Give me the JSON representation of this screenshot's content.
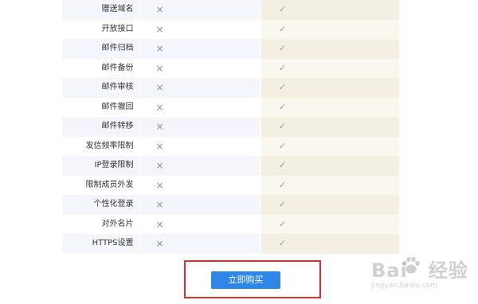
{
  "features": [
    {
      "name": "赠送域名",
      "basic": "×",
      "premium": "✓"
    },
    {
      "name": "开放接口",
      "basic": "×",
      "premium": "✓"
    },
    {
      "name": "邮件归档",
      "basic": "×",
      "premium": "✓"
    },
    {
      "name": "邮件备份",
      "basic": "×",
      "premium": "✓"
    },
    {
      "name": "邮件审核",
      "basic": "×",
      "premium": "✓"
    },
    {
      "name": "邮件撤回",
      "basic": "×",
      "premium": "✓"
    },
    {
      "name": "邮件转移",
      "basic": "×",
      "premium": "✓"
    },
    {
      "name": "发信频率限制",
      "basic": "×",
      "premium": "✓"
    },
    {
      "name": "IP登录限制",
      "basic": "×",
      "premium": "✓"
    },
    {
      "name": "限制成员外发",
      "basic": "×",
      "premium": "✓"
    },
    {
      "name": "个性化登录",
      "basic": "×",
      "premium": "✓"
    },
    {
      "name": "对外名片",
      "basic": "×",
      "premium": "✓"
    },
    {
      "name": "HTTPS设置",
      "basic": "×",
      "premium": "✓"
    }
  ],
  "buy_button": {
    "label": "立即购买"
  },
  "watermark": {
    "logo_left": "Bai",
    "logo_right": "经验",
    "url": "jingyan.baidu.com"
  },
  "colors": {
    "button": "#2d86e8",
    "highlight_border": "#e52c2c"
  }
}
